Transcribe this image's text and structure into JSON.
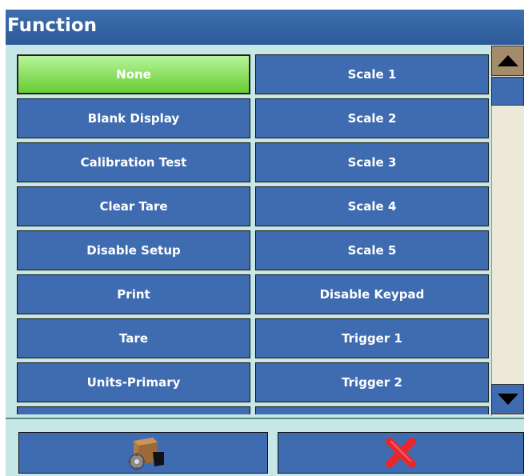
{
  "window": {
    "title": "Function"
  },
  "grid": {
    "left_column": [
      "None",
      "Blank Display",
      "Calibration Test",
      "Clear Tare",
      "Disable Setup",
      "Print",
      "Tare",
      "Units-Primary"
    ],
    "right_column": [
      "Scale 1",
      "Scale 2",
      "Scale 3",
      "Scale 4",
      "Scale 5",
      "Disable Keypad",
      "Trigger 1",
      "Trigger 2"
    ],
    "selected": "None"
  },
  "scrollbar": {
    "up_icon": "triangle-up-icon",
    "down_icon": "triangle-down-icon"
  },
  "softkeys": [
    {
      "icon": "exit-box-gear-icon"
    },
    {
      "icon": "red-x-cancel-icon"
    }
  ],
  "colors": {
    "title_bar": "#2d5a98",
    "button": "#3f6cb1",
    "selected_button": "#66cc33",
    "background": "#c7e6e6",
    "cancel_x": "#e8262e"
  }
}
